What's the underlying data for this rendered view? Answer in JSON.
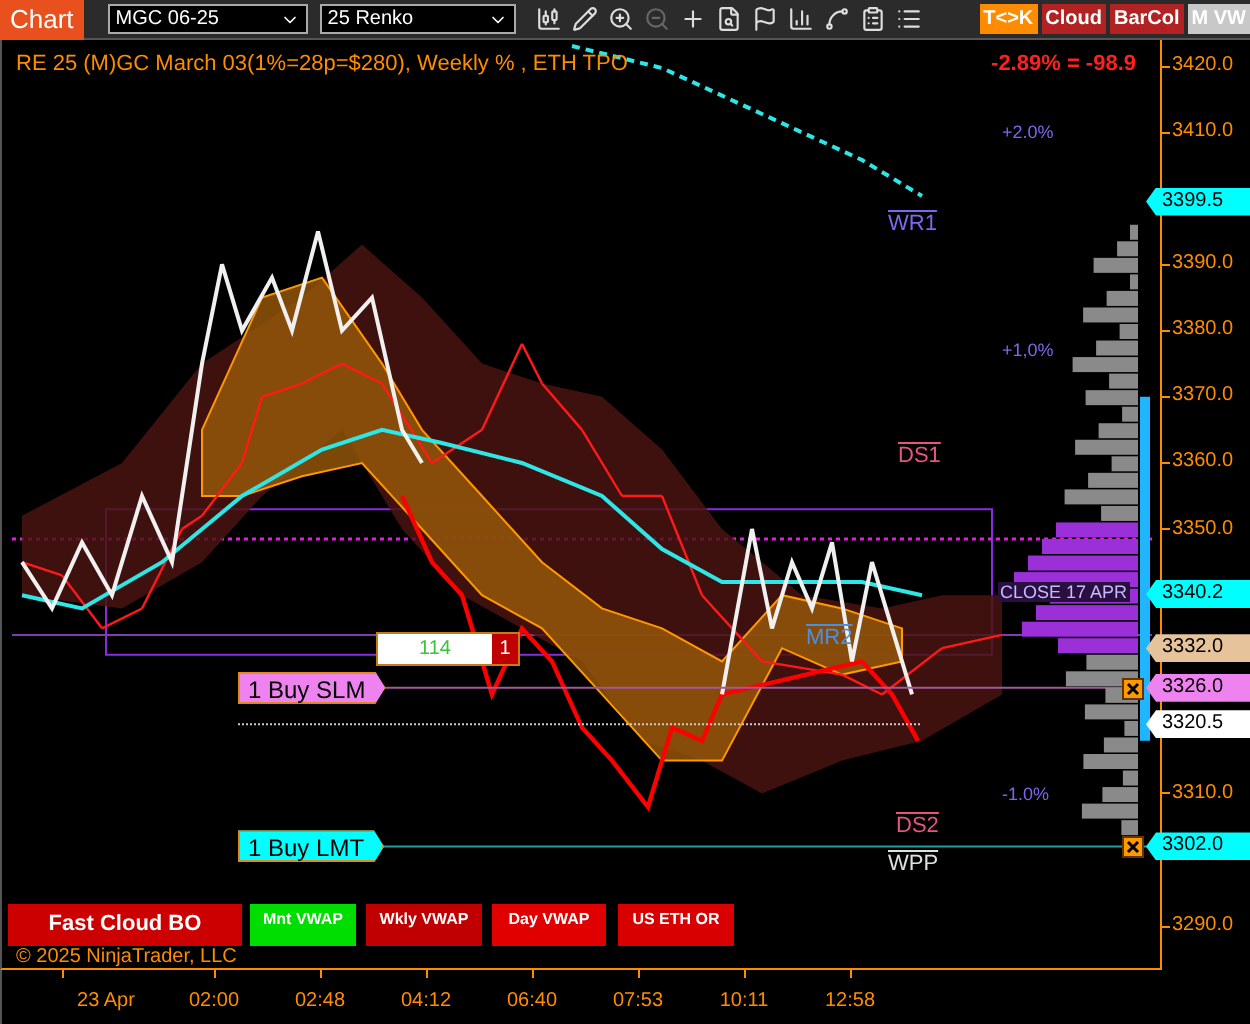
{
  "toolbar": {
    "chart_button": "Chart",
    "instrument": "MGC 06-25",
    "bar_type": "25 Renko",
    "toggles": [
      {
        "label": "T<>K",
        "color": "#ff8c00"
      },
      {
        "label": "Cloud",
        "color": "#b22222"
      },
      {
        "label": "BarCol",
        "color": "#b22222"
      },
      {
        "label": "M VW",
        "color": "#c8c8c8"
      }
    ]
  },
  "chart": {
    "title": "RE 25 (M)GC March 03(1%=28p=$280), Weekly % , ETH TPO",
    "change": "-2.89% = -98.9",
    "percent_levels": [
      "+2.0%",
      "+1,0%",
      "-1.0%"
    ],
    "pivots": [
      {
        "label": "WR1",
        "color": "#7b68ee"
      },
      {
        "label": "DS1",
        "color": "#e75480"
      },
      {
        "label": "MR2",
        "color": "#4a90e2"
      },
      {
        "label": "DS2",
        "color": "#e75480"
      },
      {
        "label": "WPP",
        "color": "#e0e0e0"
      }
    ],
    "profile_label": "CLOSE 17 APR",
    "position": {
      "quantity": "114",
      "count": "1"
    },
    "orders": [
      {
        "label": "1 Buy SLM",
        "color": "#ee82ee"
      },
      {
        "label": "1 Buy LMT",
        "color": "#00ffff"
      }
    ],
    "indicator_buttons": [
      {
        "label": "Fast Cloud BO",
        "color": "#cc0000"
      },
      {
        "label": "Mnt VWAP",
        "color": "#00dd00"
      },
      {
        "label": "Wkly VWAP",
        "color": "#c00000"
      },
      {
        "label": "Day VWAP",
        "color": "#e00000"
      },
      {
        "label": "US ETH OR",
        "color": "#d80000"
      }
    ],
    "copyright": "© 2025 NinjaTrader, LLC"
  },
  "price_axis": {
    "ticks": [
      "3420.0",
      "3410.0",
      "3390.0",
      "3380.0",
      "3370.0",
      "3360.0",
      "3350.0",
      "3310.0",
      "3290.0"
    ],
    "markers": [
      {
        "label": "3399.5",
        "color": "#00ffff"
      },
      {
        "label": "3340.2",
        "color": "#00ffff"
      },
      {
        "label": "3332.0",
        "color": "#e6c39a"
      },
      {
        "label": "3326.0",
        "color": "#ee82ee"
      },
      {
        "label": "3320.5",
        "color": "#ffffff"
      },
      {
        "label": "3302.0",
        "color": "#00ffff"
      }
    ]
  },
  "time_axis": {
    "ticks": [
      "23 Apr",
      "02:00",
      "02:48",
      "04:12",
      "06:40",
      "07:53",
      "10:11",
      "12:58"
    ]
  }
}
